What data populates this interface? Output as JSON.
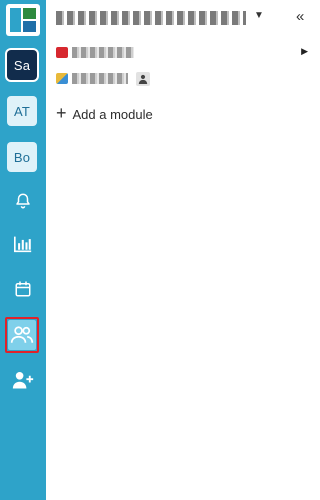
{
  "sidebar": {
    "workspaces": [
      {
        "initials": "Sa",
        "active": true
      },
      {
        "initials": "AT",
        "active": false
      },
      {
        "initials": "Bo",
        "active": false
      }
    ],
    "nav_icons": [
      "bell-icon",
      "chart-icon",
      "calendar-icon",
      "people-icon",
      "add-user-icon"
    ],
    "selected_nav": "people-icon"
  },
  "header": {
    "workspace_name": "",
    "collapse_glyph": "«"
  },
  "modules": [
    {
      "icon": "module-icon",
      "title": "",
      "expandable": true
    },
    {
      "icon": "module-icon",
      "title": "",
      "has_person_badge": true
    }
  ],
  "add_module": {
    "label": "Add a module"
  },
  "colors": {
    "rail": "#2ea3c9",
    "active_workspace": "#112c4c",
    "selected_highlight": "#e0222a"
  }
}
